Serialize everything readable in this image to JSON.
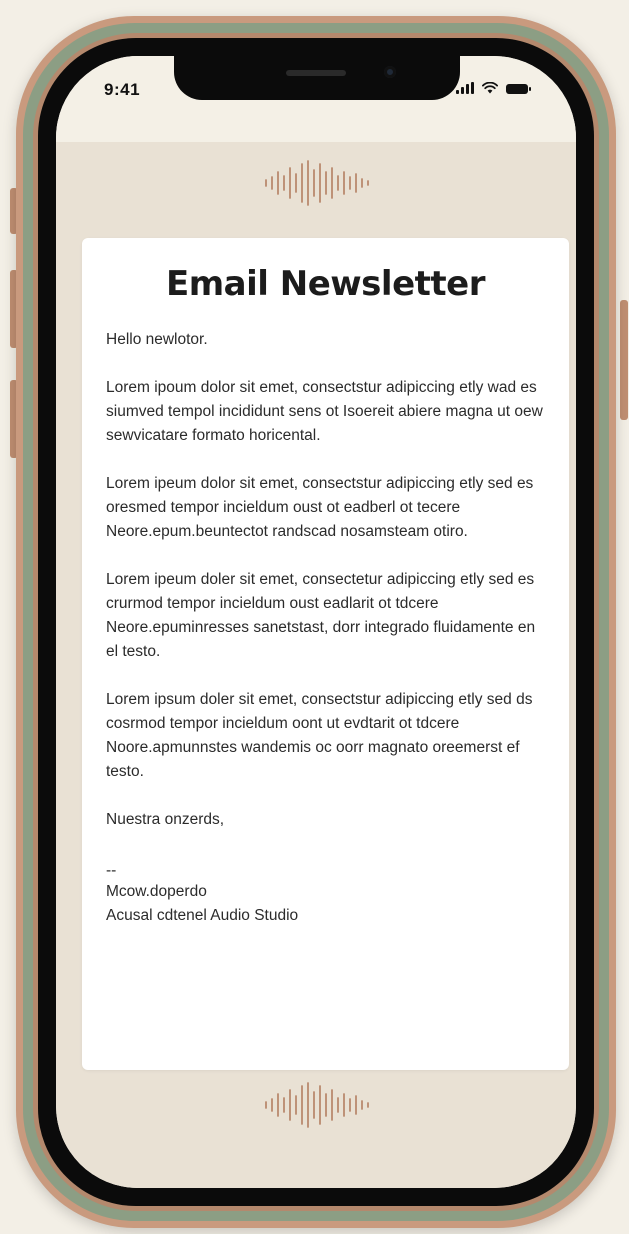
{
  "status_bar": {
    "time": "9:41"
  },
  "email": {
    "title": "Email Newsletter",
    "greeting": "Hello newlotor.",
    "paragraphs": [
      "Lorem ipoum dolor sit emet, consectstur adipiccing etly wad es siumved tempol incididunt sens ot Isoereit abiere magna ut oew sewvicatare formato horicental.",
      "Lorem ipeum dolor sit emet, consectstur adipiccing etly sed es oresmed tempor incieldum oust ot eadberl ot tecere Neore.epum.beuntectot randscad nosamsteam otiro.",
      "Lorem ipeum doler sit emet, consectetur adipiccing etly sed es crurmod tempor incieldum oust eadlarit ot tdcere Neore.epuminresses sanetstast, dorr integrado fluidamente en el testo.",
      "Lorem ipsum doler sit emet, consectstur adipiccing etly sed ds cosrmod tempor incieldum oont ut evdtarit ot tdcere Noore.apmunnstes wandemis oc oorr magnato oreemerst ef testo."
    ],
    "closing": "Nuestra onzerds,",
    "signature_separator": "--",
    "signature_name": "Mcow.doperdo",
    "signature_company": "Acusal cdtenel Audio Studio"
  },
  "colors": {
    "phone_frame_copper": "#c99a7e",
    "phone_frame_green": "#8c9e84",
    "app_background": "#e9e1d4",
    "card_background": "#ffffff",
    "wave_icon": "#b98a6e"
  },
  "icons": {
    "top_logo": "sound-wave-icon",
    "bottom_logo": "sound-wave-icon",
    "signal": "signal-bars-icon",
    "wifi": "wifi-icon",
    "battery": "battery-icon"
  }
}
